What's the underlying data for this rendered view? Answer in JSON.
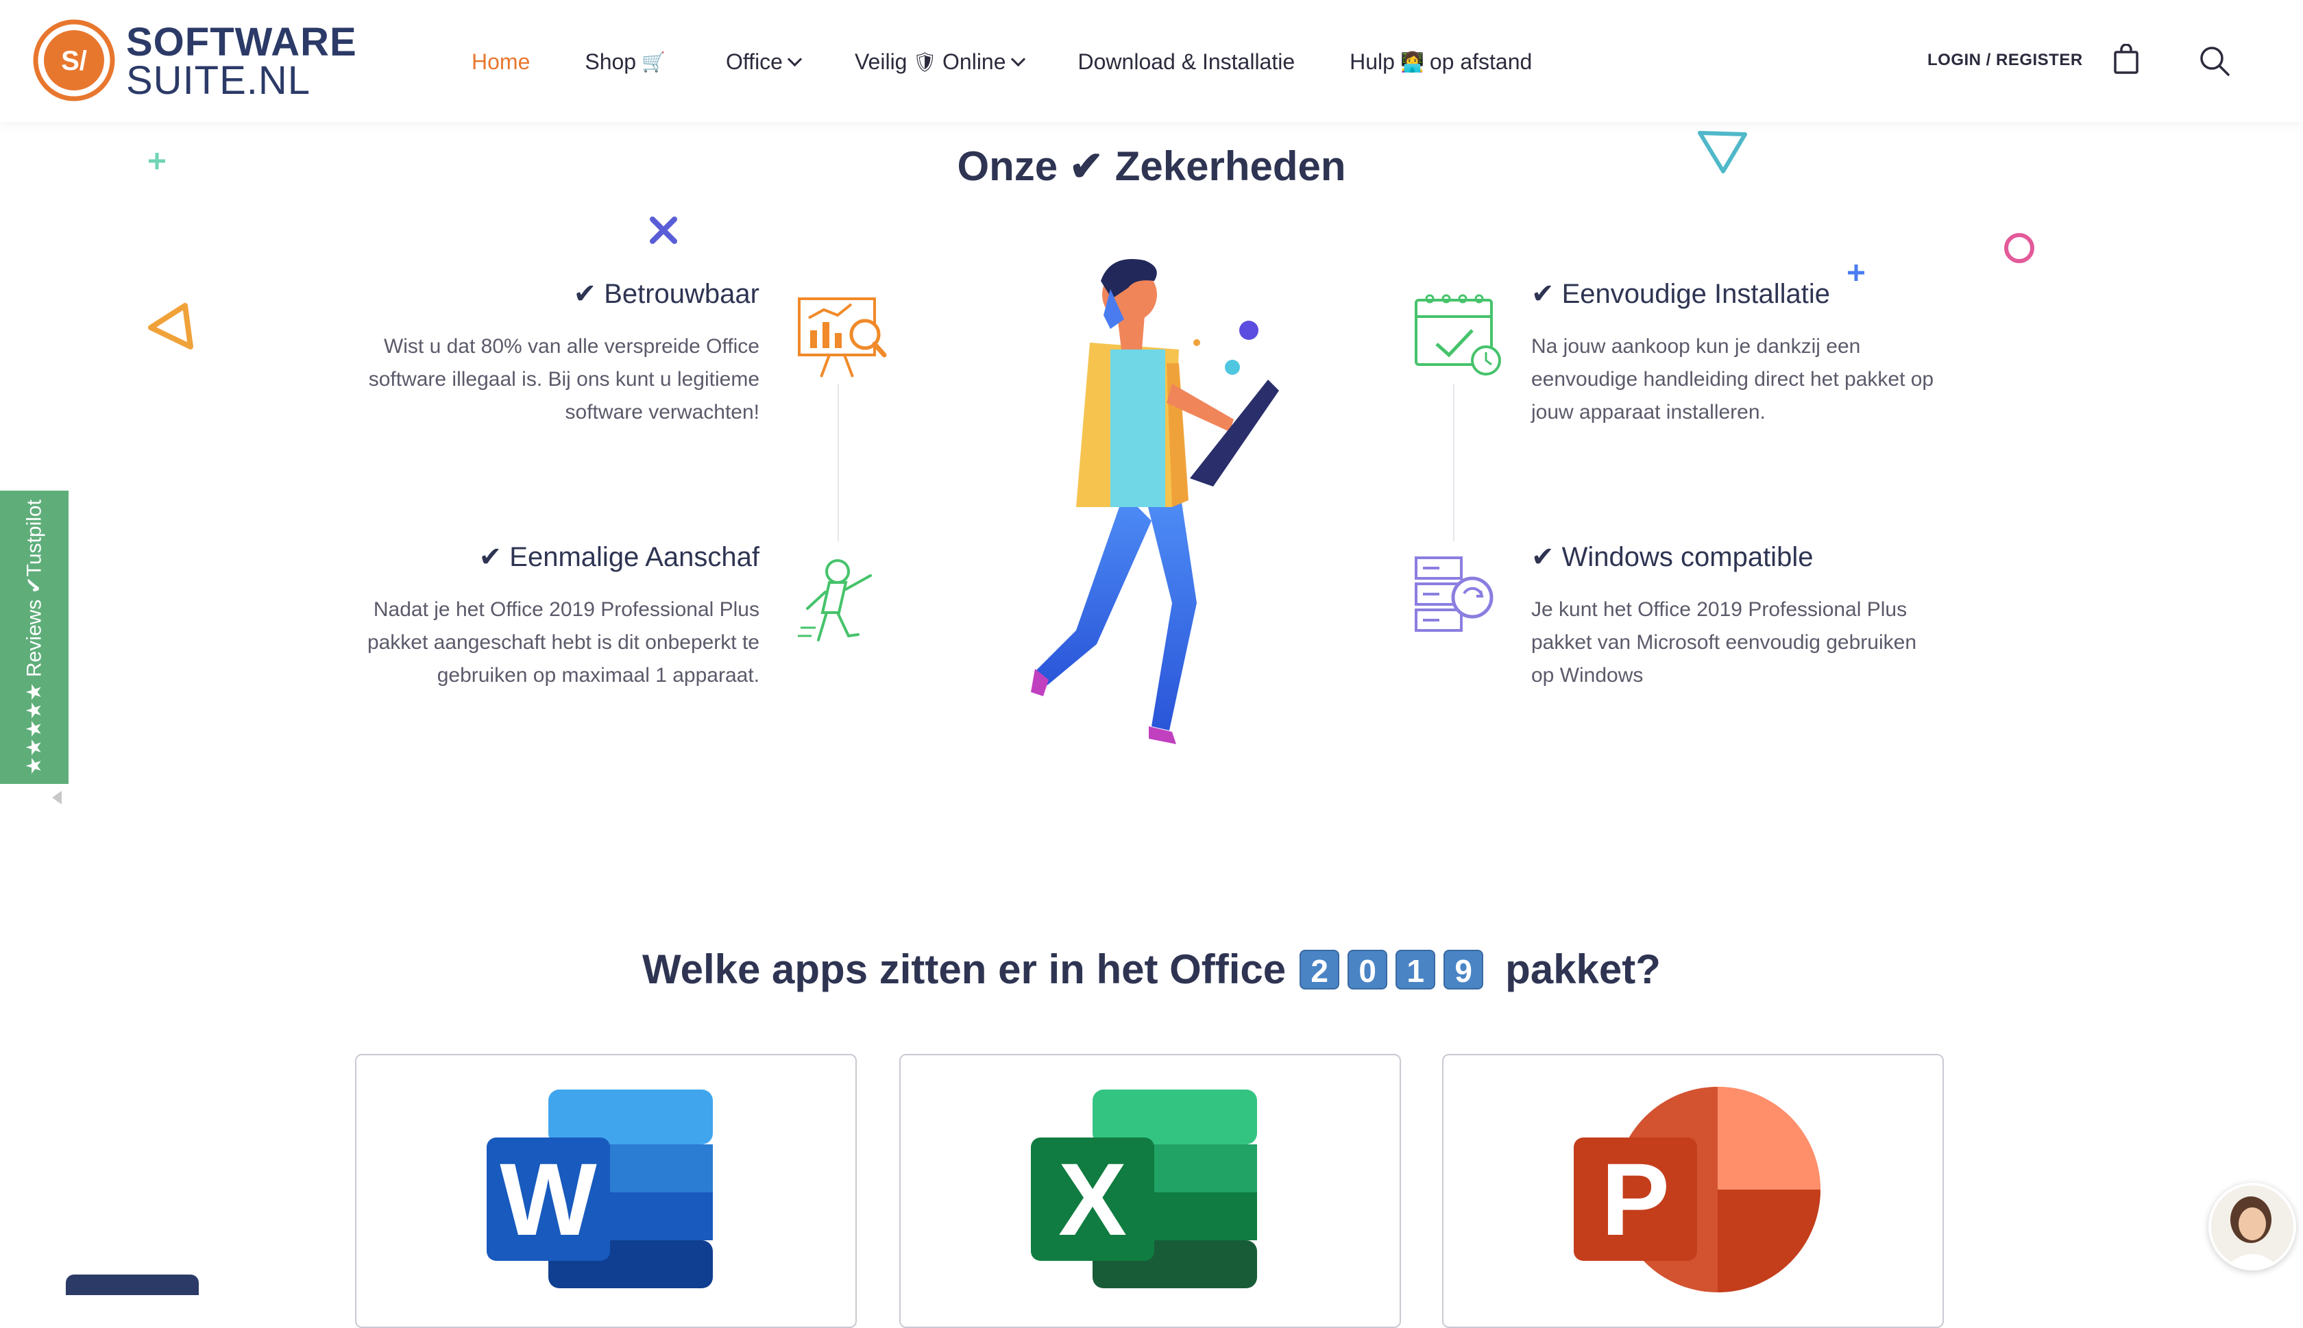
{
  "header": {
    "logo": {
      "line1": "SOFTWARE",
      "line2": "SUITE.NL",
      "mark_text": "S/"
    },
    "nav": [
      {
        "label": "Home",
        "active": true
      },
      {
        "label": "Shop",
        "emoji": "🛒"
      },
      {
        "label": "Office",
        "dropdown": true
      },
      {
        "label_before": "Veilig",
        "emoji": "🛡",
        "label_after": "Online",
        "dropdown": true
      },
      {
        "label": "Download & Installatie"
      },
      {
        "label_before": "Hulp",
        "emoji": "👩‍💻",
        "label_after": "op afstand"
      }
    ],
    "login": "LOGIN / REGISTER",
    "icons": {
      "cart": "bag-icon",
      "search": "search-icon"
    }
  },
  "section1": {
    "title": "Onze ✔ Zekerheden",
    "features": [
      {
        "title": "✔ Betrouwbaar",
        "text": "Wist u dat 80% van alle verspreide Office software illegaal is. Bij ons kunt u legitieme software verwachten!",
        "icon": "presentation-chart-icon"
      },
      {
        "title": "✔ Eenmalige Aanschaf",
        "text": "Nadat je het Office 2019 Professional Plus pakket aangeschaft hebt is dit onbeperkt te gebruiken op maximaal 1 apparaat.",
        "icon": "rocket-person-icon"
      },
      {
        "title": "✔ Eenvoudige Installatie",
        "text": "Na jouw aankoop kun je dankzij een eenvoudige handleiding direct het pakket op jouw apparaat installeren.",
        "icon": "calendar-check-icon"
      },
      {
        "title": "✔ Windows compatible",
        "text": "Je kunt het Office 2019 Professional Plus pakket van Microsoft eenvoudig gebruiken op Windows",
        "icon": "server-refresh-icon"
      }
    ]
  },
  "section2": {
    "title_before": "Welke apps zitten er in het Office",
    "digits": [
      "2",
      "0",
      "1",
      "9"
    ],
    "title_after": "pakket?",
    "apps": [
      {
        "letter": "W",
        "icon": "word-icon",
        "color": "#2b579a"
      },
      {
        "letter": "X",
        "icon": "excel-icon",
        "color": "#217346"
      },
      {
        "letter": "P",
        "icon": "powerpoint-icon",
        "color": "#c4472b"
      }
    ]
  },
  "trustpilot": {
    "text": "★★★★★ Reviews ✔Tustpilot"
  },
  "colors": {
    "accent": "#e8772e",
    "navy": "#2b3a67",
    "green": "#5fae7a"
  }
}
